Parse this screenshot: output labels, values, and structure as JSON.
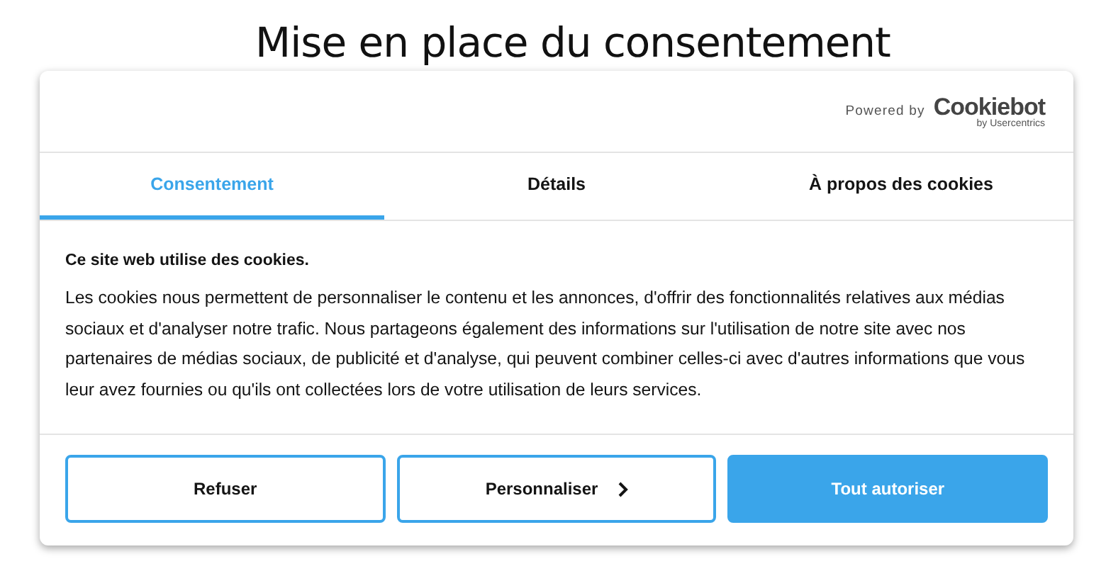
{
  "title": "Mise en place du consentement",
  "header": {
    "powered_by": "Powered by",
    "logo": "Cookiebot",
    "logo_sub": "by Usercentrics"
  },
  "tabs": [
    {
      "label": "Consentement",
      "selected": true
    },
    {
      "label": "Détails",
      "selected": false
    },
    {
      "label": "À propos des cookies",
      "selected": false
    }
  ],
  "body": {
    "heading": "Ce site web utilise des cookies.",
    "text": "Les cookies nous permettent de personnaliser le contenu et les annonces, d'offrir des fonctionnalités relatives aux médias sociaux et d'analyser notre trafic. Nous partageons également des informations sur l'utilisation de notre site avec nos partenaires de médias sociaux, de publicité et d'analyse, qui peuvent combiner celles-ci avec d'autres informations que vous leur avez fournies ou qu'ils ont collectées lors de votre utilisation de leurs services."
  },
  "buttons": [
    {
      "label": "Refuser",
      "kind": "outline",
      "chevron": false
    },
    {
      "label": "Personnaliser",
      "kind": "outline",
      "chevron": true
    },
    {
      "label": "Tout autoriser",
      "kind": "filled",
      "chevron": false
    }
  ]
}
